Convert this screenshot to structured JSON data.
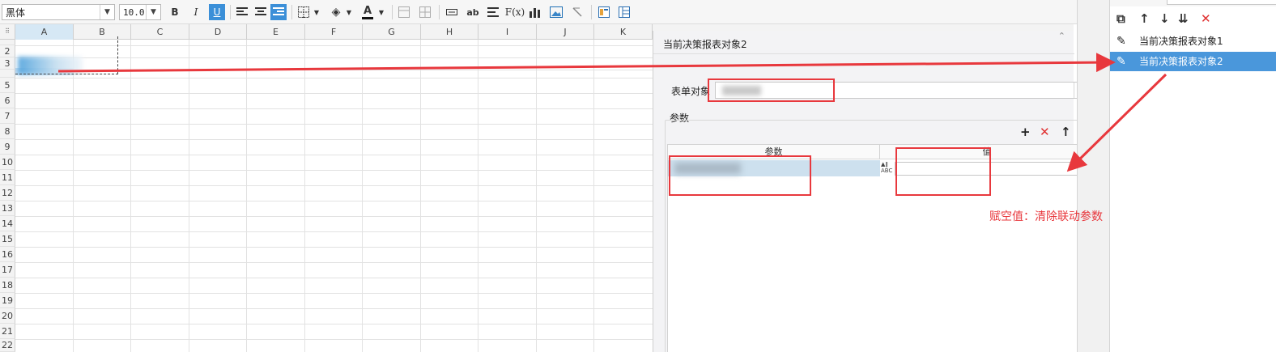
{
  "toolbar": {
    "font_family": "黑体",
    "font_size": "10.0",
    "bold": "B",
    "italic": "I",
    "underline": "U",
    "text_label": "ab",
    "formula_label": "F(x)",
    "font_color_label": "A",
    "side_icon": "settings-icon"
  },
  "sheet": {
    "corner": "⠿",
    "columns": [
      "A",
      "B",
      "C",
      "D",
      "E",
      "F",
      "G",
      "H",
      "I",
      "J",
      "K"
    ],
    "rows": [
      "2",
      "3",
      "5",
      "6",
      "7",
      "8",
      "9",
      "10",
      "11",
      "12",
      "13",
      "14",
      "15",
      "16",
      "17",
      "18",
      "19",
      "20",
      "21",
      "22"
    ]
  },
  "dialog": {
    "title": "当前决策报表对象2",
    "form_object_label": "表单对象",
    "params_label": "参数",
    "param_col_header": "参数",
    "value_col_header": "值",
    "abc_badge": "ABC"
  },
  "side_list": {
    "items": [
      {
        "label": "当前决策报表对象1"
      },
      {
        "label": "当前决策报表对象2"
      }
    ]
  },
  "annotation": {
    "text": "赋空值：清除联动参数",
    "color": "#e8383d"
  },
  "colors": {
    "selected_item": "#4a97db",
    "accent_red": "#e8383d"
  }
}
